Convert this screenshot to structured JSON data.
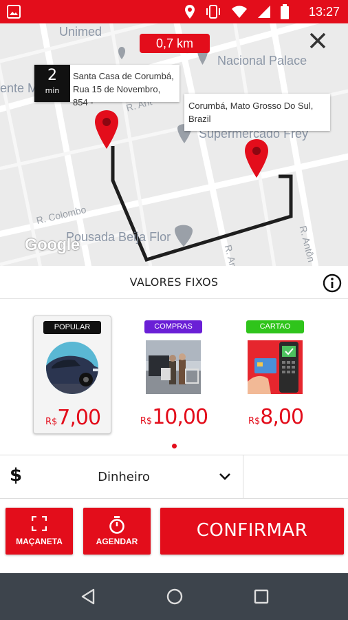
{
  "status_bar": {
    "time": "13:27",
    "icons": [
      "image-icon",
      "location-icon",
      "vibrate-icon",
      "wifi-icon",
      "signal-icon",
      "battery-icon"
    ]
  },
  "map": {
    "distance": "0,7 km",
    "places": [
      "Unimed",
      "Nacional Palace",
      "Supermercado Frey",
      "Pousada Beija Flor",
      "ente M"
    ],
    "streets": [
      "R. Ant",
      "R. Colombo",
      "R. Antôn",
      "R. Antô"
    ],
    "attribution": "Google",
    "eta": {
      "value": "2",
      "unit": "min"
    },
    "origin_address": "Santa Casa de Corumbá, Rua 15 de Novembro, 854 -",
    "destination_address": "Corumbá, Mato Grosso Do Sul, Brazil"
  },
  "fixed_values": {
    "title": "VALORES FIXOS"
  },
  "options": [
    {
      "badge": "POPULAR",
      "badge_color": "#111111",
      "currency": "R$",
      "price": "7,00",
      "selected": true
    },
    {
      "badge": "COMPRAS",
      "badge_color": "#6a1fd6",
      "currency": "R$",
      "price": "10,00",
      "selected": false
    },
    {
      "badge": "CARTAO",
      "badge_color": "#2fc41b",
      "currency": "R$",
      "price": "8,00",
      "selected": false
    }
  ],
  "payment": {
    "symbol": "$",
    "method": "Dinheiro"
  },
  "actions": {
    "handle_label": "MAÇANETA",
    "schedule_label": "AGENDAR",
    "confirm_label": "CONFIRMAR"
  },
  "colors": {
    "accent": "#e30d1b",
    "navbar": "#3d444c"
  }
}
